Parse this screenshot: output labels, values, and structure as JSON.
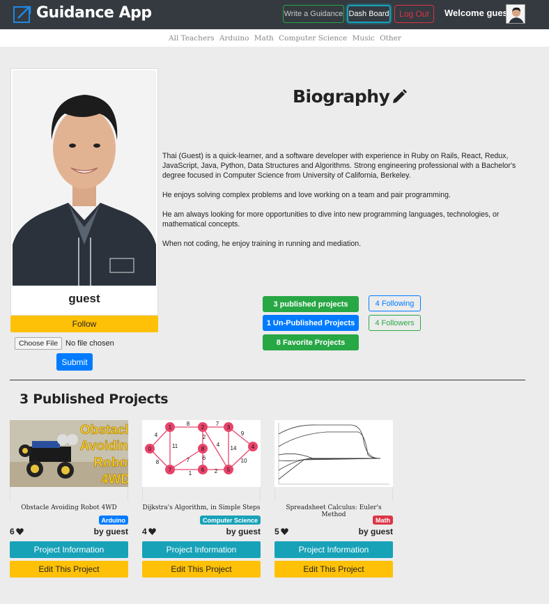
{
  "header": {
    "brand": "Guidance App",
    "logo_icon": "external-link-icon",
    "write_label": "Write a Guidance",
    "dash_label": "Dash Board",
    "logout_label": "Log Out",
    "welcome": "Welcome guest"
  },
  "subnav": [
    "All Teachers",
    "Arduino",
    "Math",
    "Computer Science",
    "Music",
    "Other"
  ],
  "profile": {
    "name": "guest",
    "follow_label": "Follow",
    "choose_file_label": "Choose File",
    "no_file_label": "No file chosen",
    "submit_label": "Submit"
  },
  "bio": {
    "title": "Biography",
    "edit_icon": "pencil-icon",
    "paragraphs": [
      "Thai (Guest) is a quick-learner, and a software developer with experience in Ruby on Rails, React, Redux, JavaScript, Java, Python, Data Structures and Algorithms. Strong engineering professional with a Bachelor's degree focused in Computer Science from University of California, Berkeley.",
      "He enjoys solving complex problems and love working on a team and pair programming.",
      "He am always looking for more opportunities to dive into new programming languages, technologies, or mathematical concepts.",
      "When not coding, he enjoy training in running and mediation."
    ]
  },
  "stats": {
    "published": "3 published projects",
    "unpublished": "1 Un-Published Projects",
    "favorite": "8 Favorite Projects",
    "following": "4 Following",
    "followers": "4 Followers"
  },
  "projects_section": {
    "title": "3 Published Projects"
  },
  "projects": [
    {
      "title": "Obstacle Avoiding Robot 4WD",
      "image_text": [
        "Obstacle",
        "Avoiding",
        "Robot",
        "4WD"
      ],
      "badge": "Arduino",
      "badge_color": "#007bff",
      "likes": "6",
      "author": "by guest",
      "info_label": "Project Information",
      "edit_label": "Edit This Project"
    },
    {
      "title": "Dijkstra's Algorithm, in Simple Steps",
      "graph_labels": [
        "0",
        "1",
        "2",
        "3",
        "4",
        "5",
        "6",
        "7",
        "8",
        "8",
        "7",
        "4",
        "9",
        "14",
        "10",
        "2",
        "1",
        "6",
        "7",
        "8",
        "11",
        "4",
        "2"
      ],
      "badge": "Computer Science",
      "badge_color": "#17a2b8",
      "likes": "4",
      "author": "by guest",
      "info_label": "Project Information",
      "edit_label": "Edit This Project"
    },
    {
      "title": "Spreadsheet Calculus: Euler's Method",
      "badge": "Math",
      "badge_color": "#dc3545",
      "likes": "5",
      "author": "by guest",
      "info_label": "Project Information",
      "edit_label": "Edit This Project"
    }
  ],
  "colors": {
    "navbar": "#343a40",
    "success": "#28a745",
    "primary": "#007bff",
    "info": "#17a2b8",
    "warning": "#ffc107",
    "danger": "#dc3545"
  }
}
